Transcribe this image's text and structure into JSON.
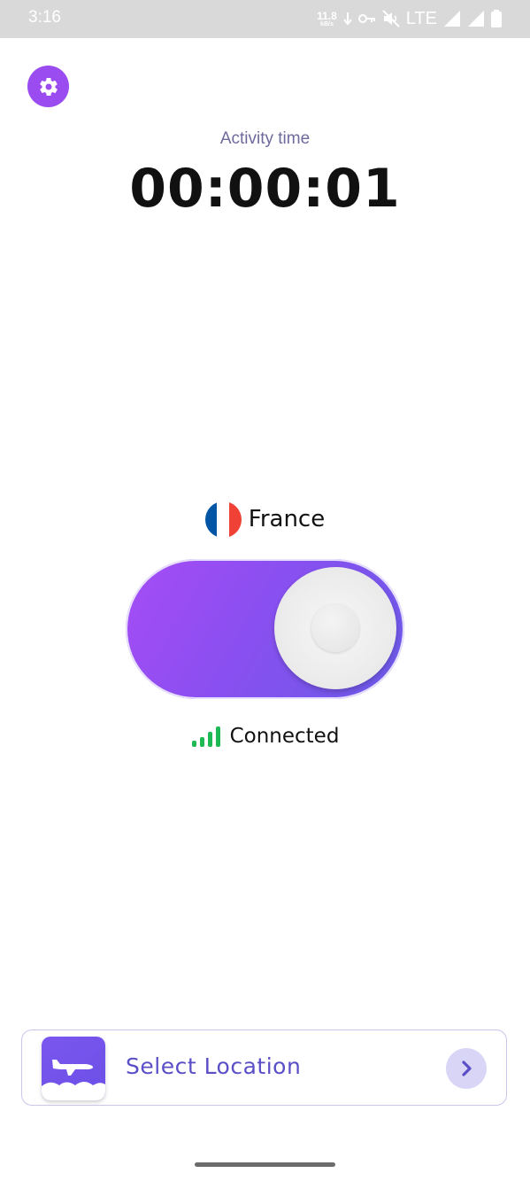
{
  "status_bar": {
    "time": "3:16",
    "net_speed_value": "11.8",
    "net_speed_unit": "kB/s",
    "network_type": "LTE",
    "icons": [
      "download-arrow-icon",
      "vpn-key-icon",
      "mute-icon",
      "signal-icon",
      "signal-icon",
      "battery-icon"
    ]
  },
  "header": {
    "settings_icon": "gear-icon",
    "activity_label": "Activity time",
    "timer": "00:00:01"
  },
  "connection": {
    "country": "France",
    "flag_colors": [
      "#0055a4",
      "#ffffff",
      "#ef4135"
    ],
    "toggle_state": "on",
    "status": "Connected",
    "status_color": "#1db954",
    "toggle_gradient": [
      "#a64cf5",
      "#6a5be8"
    ]
  },
  "location_card": {
    "label": "Select Location",
    "icon": "airplane-icon",
    "chevron_icon": "chevron-right-icon"
  },
  "colors": {
    "accent": "#9b4cf0",
    "card_text": "#5a4fc7"
  }
}
